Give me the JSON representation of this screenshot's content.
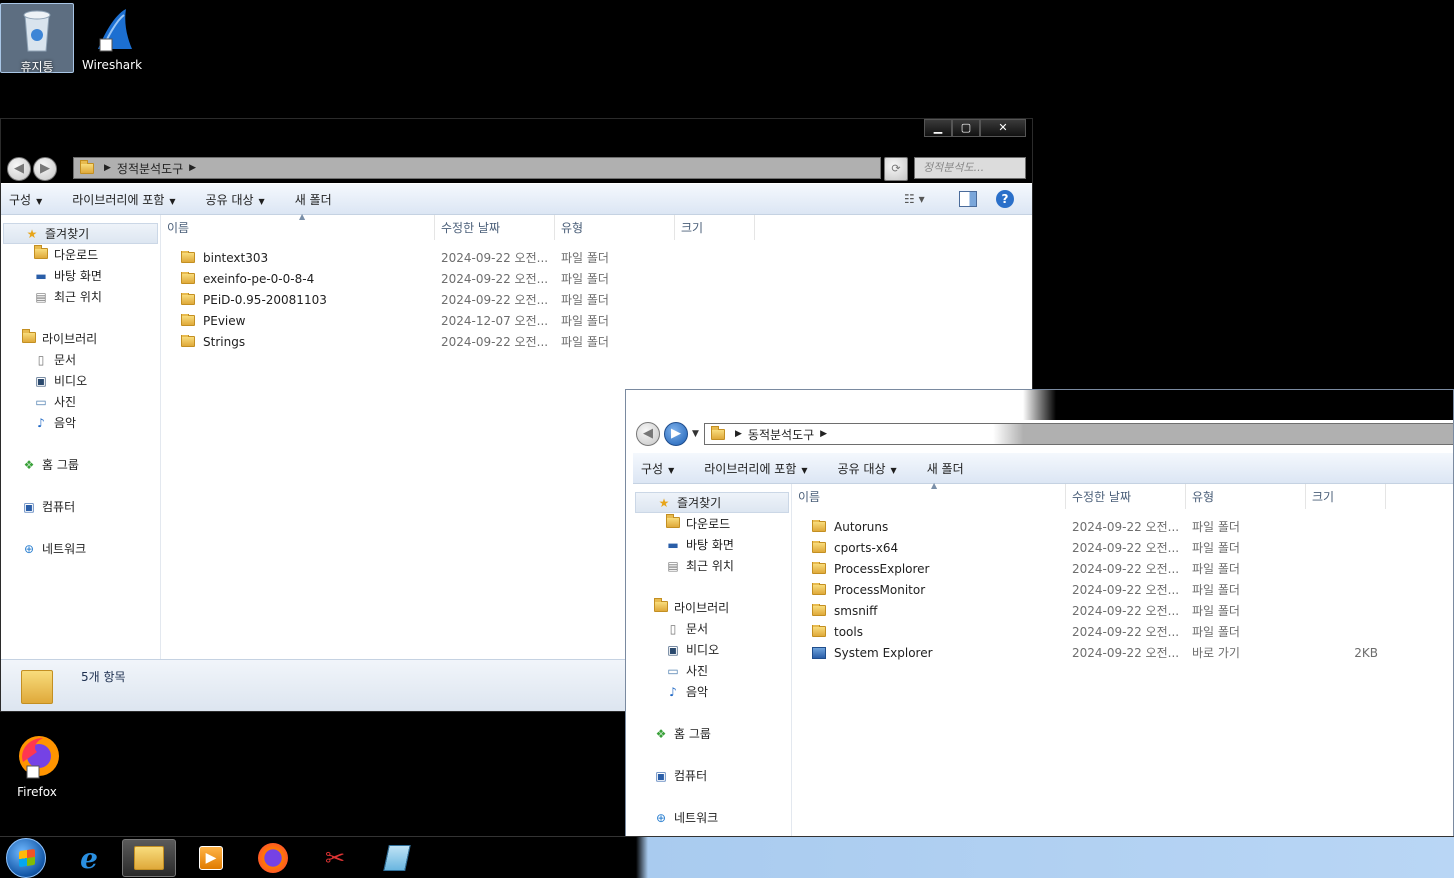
{
  "desktop": {
    "icons": [
      {
        "label": "휴지통",
        "icon": "recycle-bin-icon"
      },
      {
        "label": "Wireshark",
        "icon": "wireshark-icon"
      },
      {
        "label": "Firefox",
        "icon": "firefox-icon"
      }
    ]
  },
  "window1": {
    "controls": {
      "minimize": "▁",
      "maximize": "▢",
      "close": "✕"
    },
    "breadcrumb": "정적분석도구",
    "search_placeholder": "정적분석도...",
    "toolbar": {
      "organize": "구성",
      "include_library": "라이브러리에 포함",
      "share_with": "공유 대상",
      "new_folder": "새 폴더"
    },
    "nav": {
      "favorites": "즐겨찾기",
      "downloads": "다운로드",
      "desktop": "바탕 화면",
      "recent": "최근 위치",
      "libraries": "라이브러리",
      "documents": "문서",
      "videos": "비디오",
      "pictures": "사진",
      "music": "음악",
      "homegroup": "홈 그룹",
      "computer": "컴퓨터",
      "network": "네트워크"
    },
    "columns": {
      "name": "이름",
      "date": "수정한 날짜",
      "type": "유형",
      "size": "크기"
    },
    "files": [
      {
        "name": "bintext303",
        "date": "2024-09-22 오전...",
        "type": "파일 폴더",
        "size": ""
      },
      {
        "name": "exeinfo-pe-0-0-8-4",
        "date": "2024-09-22 오전...",
        "type": "파일 폴더",
        "size": ""
      },
      {
        "name": "PEiD-0.95-20081103",
        "date": "2024-09-22 오전...",
        "type": "파일 폴더",
        "size": ""
      },
      {
        "name": "PEview",
        "date": "2024-12-07 오전...",
        "type": "파일 폴더",
        "size": ""
      },
      {
        "name": "Strings",
        "date": "2024-09-22 오전...",
        "type": "파일 폴더",
        "size": ""
      }
    ],
    "status": "5개 항목"
  },
  "window2": {
    "breadcrumb": "동적분석도구",
    "toolbar": {
      "organize": "구성",
      "include_library": "라이브러리에 포함",
      "share_with": "공유 대상",
      "new_folder": "새 폴더"
    },
    "nav": {
      "favorites": "즐겨찾기",
      "downloads": "다운로드",
      "desktop": "바탕 화면",
      "recent": "최근 위치",
      "libraries": "라이브러리",
      "documents": "문서",
      "videos": "비디오",
      "pictures": "사진",
      "music": "음악",
      "homegroup": "홈 그룹",
      "computer": "컴퓨터",
      "network": "네트워크"
    },
    "columns": {
      "name": "이름",
      "date": "수정한 날짜",
      "type": "유형",
      "size": "크기"
    },
    "files": [
      {
        "name": "Autoruns",
        "date": "2024-09-22 오전...",
        "type": "파일 폴더",
        "size": ""
      },
      {
        "name": "cports-x64",
        "date": "2024-09-22 오전...",
        "type": "파일 폴더",
        "size": ""
      },
      {
        "name": "ProcessExplorer",
        "date": "2024-09-22 오전...",
        "type": "파일 폴더",
        "size": ""
      },
      {
        "name": "ProcessMonitor",
        "date": "2024-09-22 오전...",
        "type": "파일 폴더",
        "size": ""
      },
      {
        "name": "smsniff",
        "date": "2024-09-22 오전...",
        "type": "파일 폴더",
        "size": ""
      },
      {
        "name": "tools",
        "date": "2024-09-22 오전...",
        "type": "파일 폴더",
        "size": ""
      },
      {
        "name": "System Explorer",
        "date": "2024-09-22 오전...",
        "type": "바로 가기",
        "size": "2KB"
      }
    ]
  },
  "taskbar": {
    "items": [
      "start-orb",
      "internet-explorer-icon",
      "file-explorer-icon",
      "media-player-icon",
      "firefox-icon",
      "network-tool-icon",
      "notepad-icon"
    ]
  }
}
